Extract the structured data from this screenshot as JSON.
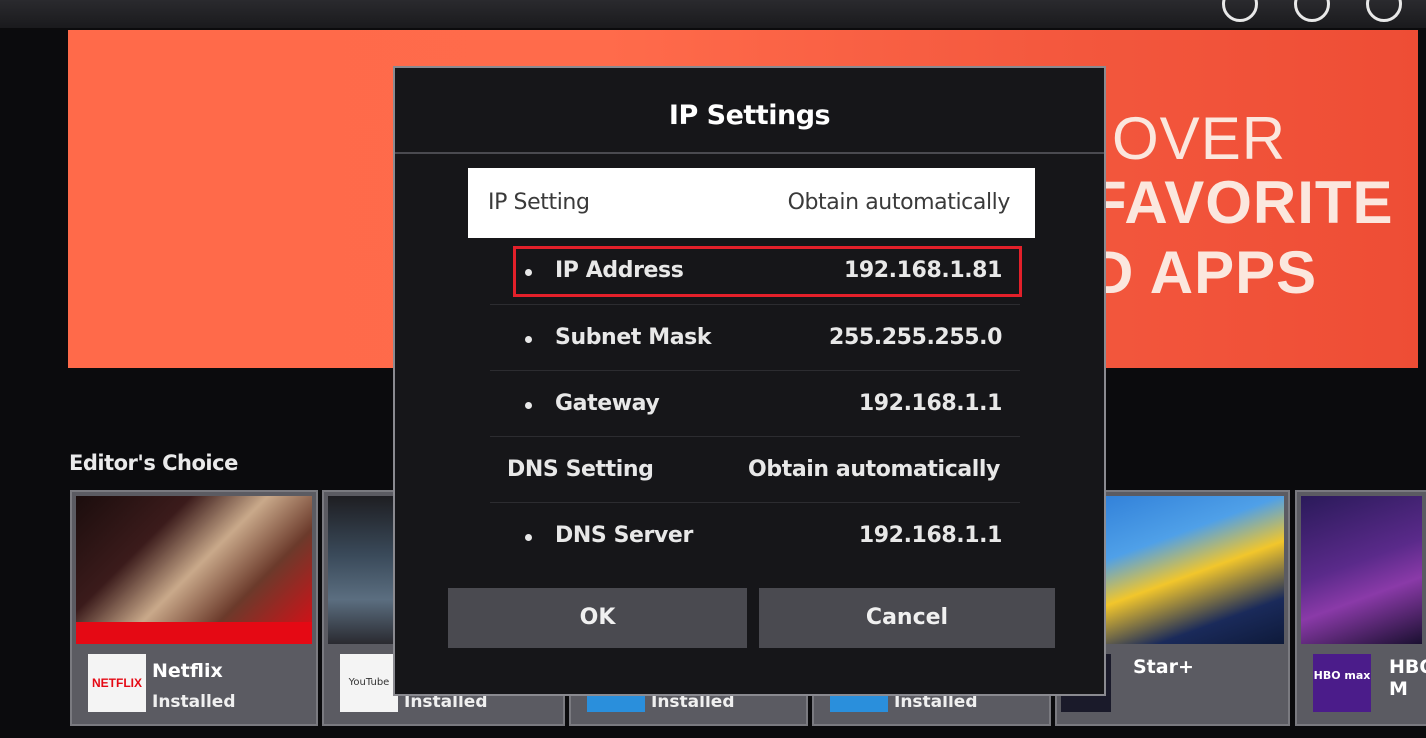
{
  "banner": {
    "line1": "OVER",
    "line2": "FAVORITE",
    "line3": "D APPS"
  },
  "section": {
    "title": "Editor's Choice"
  },
  "cards": [
    {
      "name": "Netflix",
      "status": "Installed",
      "logo": "NETFLIX"
    },
    {
      "name": "",
      "status": "Installed",
      "logo": "YouTube"
    },
    {
      "name": "",
      "status": "Installed",
      "logo": ""
    },
    {
      "name": "",
      "status": "Installed",
      "logo": ""
    },
    {
      "name": "Star+",
      "status": "",
      "logo": ""
    },
    {
      "name": "HBO M",
      "status": "",
      "logo": "HBO max"
    }
  ],
  "dialog": {
    "title": "IP Settings",
    "ip_setting": {
      "label": "IP Setting",
      "value": "Obtain automatically"
    },
    "ip_address": {
      "label": "IP Address",
      "value": "192.168.1.81"
    },
    "subnet_mask": {
      "label": "Subnet Mask",
      "value": "255.255.255.0"
    },
    "gateway": {
      "label": "Gateway",
      "value": "192.168.1.1"
    },
    "dns_setting": {
      "label": "DNS Setting",
      "value": "Obtain automatically"
    },
    "dns_server": {
      "label": "DNS Server",
      "value": "192.168.1.1"
    },
    "ok_label": "OK",
    "cancel_label": "Cancel"
  },
  "colors": {
    "banner": "#ff6a4a",
    "highlight": "#e3202a",
    "dialog_bg": "#161619",
    "button_bg": "#4a4a50"
  }
}
